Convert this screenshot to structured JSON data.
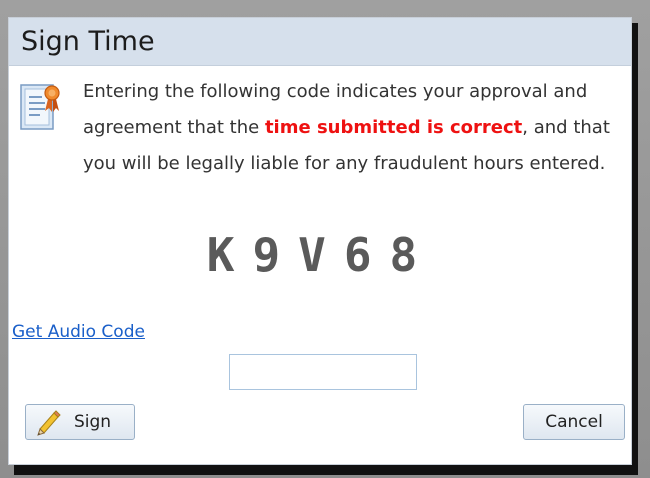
{
  "dialog": {
    "title": "Sign Time",
    "message": {
      "part1": "Entering the following code indicates your approval and agreement that the ",
      "highlight": "time submitted is correct",
      "part2": ", and that you will be legally liable for any fraudulent hours entered."
    },
    "captcha_code": "K9V68",
    "audio_link": "Get Audio Code",
    "code_input": {
      "value": "",
      "placeholder": ""
    },
    "sign_button": "Sign",
    "cancel_button": "Cancel"
  },
  "colors": {
    "titlebar": "#d6e0ec",
    "highlight": "#ee1111",
    "link": "#1a5fc9",
    "captcha": "#5a5a5a"
  },
  "icons": {
    "message_icon": "certificate-icon",
    "sign_icon": "pencil-icon"
  }
}
